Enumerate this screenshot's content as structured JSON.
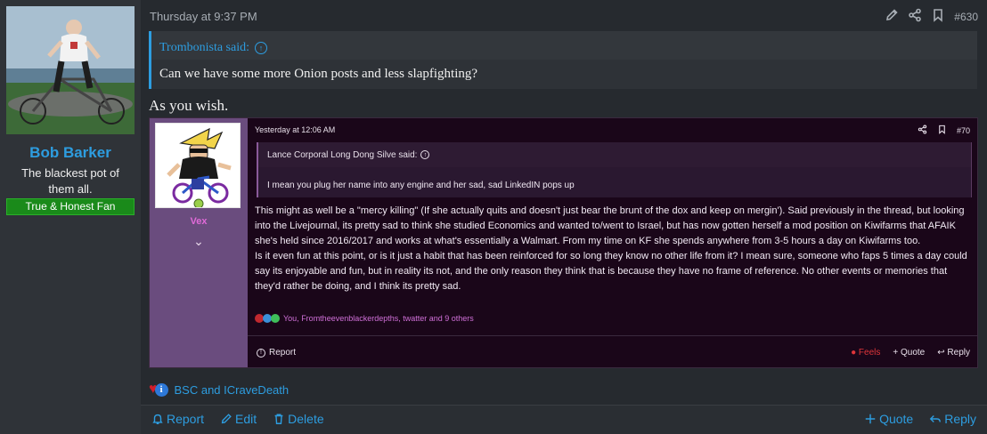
{
  "user": {
    "name": "Bob Barker",
    "title": "The blackest pot of them all.",
    "banner": "True & Honest Fan"
  },
  "post": {
    "date": "Thursday at 9:37 PM",
    "number": "#630",
    "quote": {
      "author": "Trombonista said:",
      "text": "Can we have some more Onion posts and less slapfighting?"
    },
    "body": "As you wish.",
    "reactions_text": "BSC and ICraveDeath"
  },
  "embed": {
    "user_name": "Vex",
    "date": "Yesterday at 12:06 AM",
    "number": "#70",
    "quote": {
      "author": "Lance Corporal Long Dong Silve said:",
      "text": "I mean you plug her name into any engine and her sad, sad LinkedIN pops up"
    },
    "paragraph1": "This might as well be a \"mercy killing\" (If she actually quits and doesn't just bear the brunt of the dox and keep on mergin'). Said previously in the thread, but looking into the Livejournal, its pretty sad to think she studied Economics and wanted to/went to Israel, but has now gotten herself a mod position on Kiwifarms that AFAIK she's held since 2016/2017 and works at what's essentially a Walmart. From my time on KF she spends anywhere from 3-5 hours a day on Kiwifarms too.",
    "paragraph2": "Is it even fun at this point, or is it just a habit that has been reinforced for so long they know no other life from it? I mean sure, someone who faps 5 times a day could say its enjoyable and fun, but in reality its not, and the only reason they think that is because they have no frame of reference. No other events or memories that they'd rather be doing, and I think its pretty sad.",
    "reactions_text": "You, Fromtheevenblackerdepths, twatter and 9 others",
    "report": "Report",
    "feels": "Feels",
    "quote_btn": "Quote",
    "reply_btn": "Reply"
  },
  "footer": {
    "report": "Report",
    "edit": "Edit",
    "delete": "Delete",
    "quote": "Quote",
    "reply": "Reply"
  },
  "colors": {
    "accent": "#2d9de0",
    "banner_green": "#1a8a1a",
    "embed_purple": "#6a4c7e",
    "embed_name": "#e06ad8",
    "feels_red": "#e0353a"
  }
}
